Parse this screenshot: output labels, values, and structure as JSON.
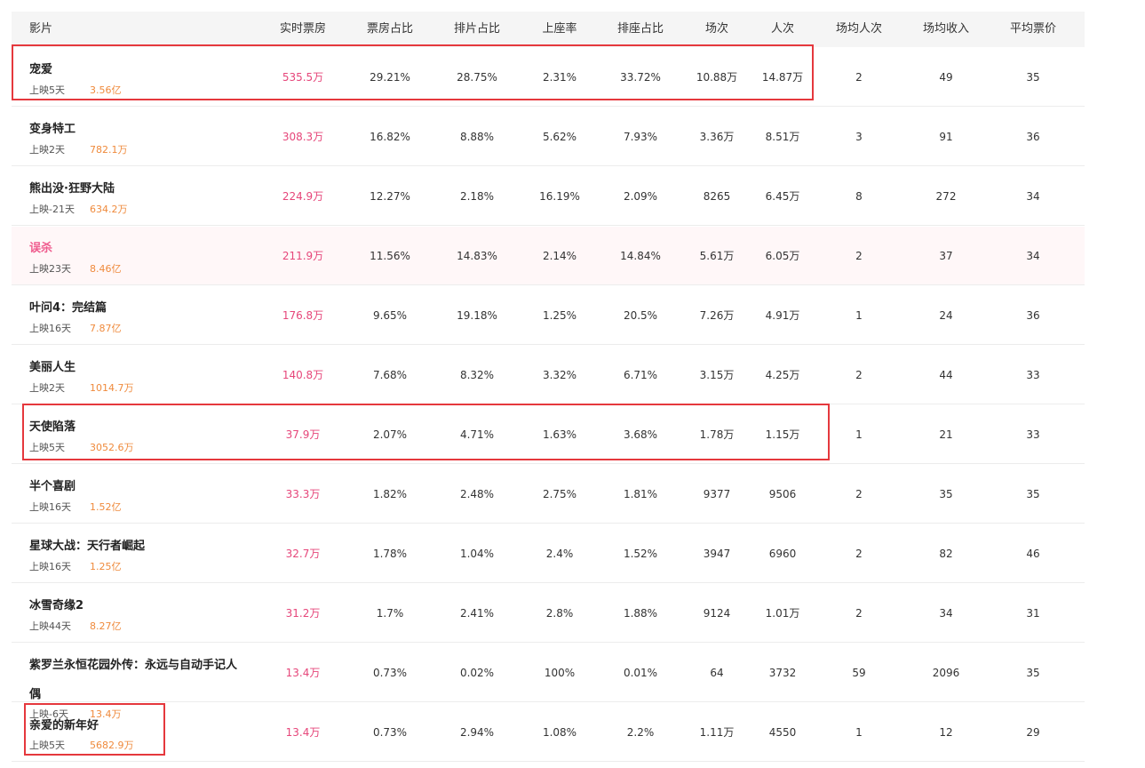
{
  "columns": [
    "影片",
    "实时票房",
    "票房占比",
    "排片占比",
    "上座率",
    "排座占比",
    "场次",
    "人次",
    "场均人次",
    "场均收入",
    "平均票价"
  ],
  "colors": {
    "boxoffice": "#e6467a",
    "total": "#ef8a3c",
    "highlight_rect": "#e5383d",
    "highlight_row": "#fff7f8"
  },
  "rows": [
    {
      "name": "宠爱",
      "days": "上映5天",
      "total": "3.56亿",
      "box": "535.5万",
      "box_pct": "29.21%",
      "show_pct": "28.75%",
      "occupancy": "2.31%",
      "seat_pct": "33.72%",
      "shows": "10.88万",
      "viewers": "14.87万",
      "avg_viewers": "2",
      "avg_income": "49",
      "avg_price": "35"
    },
    {
      "name": "变身特工",
      "days": "上映2天",
      "total": "782.1万",
      "box": "308.3万",
      "box_pct": "16.82%",
      "show_pct": "8.88%",
      "occupancy": "5.62%",
      "seat_pct": "7.93%",
      "shows": "3.36万",
      "viewers": "8.51万",
      "avg_viewers": "3",
      "avg_income": "91",
      "avg_price": "36"
    },
    {
      "name": "熊出没·狂野大陆",
      "days": "上映-21天",
      "total": "634.2万",
      "box": "224.9万",
      "box_pct": "12.27%",
      "show_pct": "2.18%",
      "occupancy": "16.19%",
      "seat_pct": "2.09%",
      "shows": "8265",
      "viewers": "6.45万",
      "avg_viewers": "8",
      "avg_income": "272",
      "avg_price": "34"
    },
    {
      "name": "误杀",
      "days": "上映23天",
      "total": "8.46亿",
      "box": "211.9万",
      "box_pct": "11.56%",
      "show_pct": "14.83%",
      "occupancy": "2.14%",
      "seat_pct": "14.84%",
      "shows": "5.61万",
      "viewers": "6.05万",
      "avg_viewers": "2",
      "avg_income": "37",
      "avg_price": "34"
    },
    {
      "name": "叶问4：完结篇",
      "days": "上映16天",
      "total": "7.87亿",
      "box": "176.8万",
      "box_pct": "9.65%",
      "show_pct": "19.18%",
      "occupancy": "1.25%",
      "seat_pct": "20.5%",
      "shows": "7.26万",
      "viewers": "4.91万",
      "avg_viewers": "1",
      "avg_income": "24",
      "avg_price": "36"
    },
    {
      "name": "美丽人生",
      "days": "上映2天",
      "total": "1014.7万",
      "box": "140.8万",
      "box_pct": "7.68%",
      "show_pct": "8.32%",
      "occupancy": "3.32%",
      "seat_pct": "6.71%",
      "shows": "3.15万",
      "viewers": "4.25万",
      "avg_viewers": "2",
      "avg_income": "44",
      "avg_price": "33"
    },
    {
      "name": "天使陷落",
      "days": "上映5天",
      "total": "3052.6万",
      "box": "37.9万",
      "box_pct": "2.07%",
      "show_pct": "4.71%",
      "occupancy": "1.63%",
      "seat_pct": "3.68%",
      "shows": "1.78万",
      "viewers": "1.15万",
      "avg_viewers": "1",
      "avg_income": "21",
      "avg_price": "33"
    },
    {
      "name": "半个喜剧",
      "days": "上映16天",
      "total": "1.52亿",
      "box": "33.3万",
      "box_pct": "1.82%",
      "show_pct": "2.48%",
      "occupancy": "2.75%",
      "seat_pct": "1.81%",
      "shows": "9377",
      "viewers": "9506",
      "avg_viewers": "2",
      "avg_income": "35",
      "avg_price": "35"
    },
    {
      "name": "星球大战：天行者崛起",
      "days": "上映16天",
      "total": "1.25亿",
      "box": "32.7万",
      "box_pct": "1.78%",
      "show_pct": "1.04%",
      "occupancy": "2.4%",
      "seat_pct": "1.52%",
      "shows": "3947",
      "viewers": "6960",
      "avg_viewers": "2",
      "avg_income": "82",
      "avg_price": "46"
    },
    {
      "name": "冰雪奇缘2",
      "days": "上映44天",
      "total": "8.27亿",
      "box": "31.2万",
      "box_pct": "1.7%",
      "show_pct": "2.41%",
      "occupancy": "2.8%",
      "seat_pct": "1.88%",
      "shows": "9124",
      "viewers": "1.01万",
      "avg_viewers": "2",
      "avg_income": "34",
      "avg_price": "31"
    },
    {
      "name": "紫罗兰永恒花园外传：永远与自动手记人",
      "name2": "偶",
      "days": "上映-6天",
      "total": "13.4万",
      "box": "13.4万",
      "box_pct": "0.73%",
      "show_pct": "0.02%",
      "occupancy": "100%",
      "seat_pct": "0.01%",
      "shows": "64",
      "viewers": "3732",
      "avg_viewers": "59",
      "avg_income": "2096",
      "avg_price": "35"
    },
    {
      "name": "亲爱的新年好",
      "days": "上映5天",
      "total": "5682.9万",
      "box": "13.4万",
      "box_pct": "0.73%",
      "show_pct": "2.94%",
      "occupancy": "1.08%",
      "seat_pct": "2.2%",
      "shows": "1.11万",
      "viewers": "4550",
      "avg_viewers": "1",
      "avg_income": "12",
      "avg_price": "29"
    }
  ]
}
